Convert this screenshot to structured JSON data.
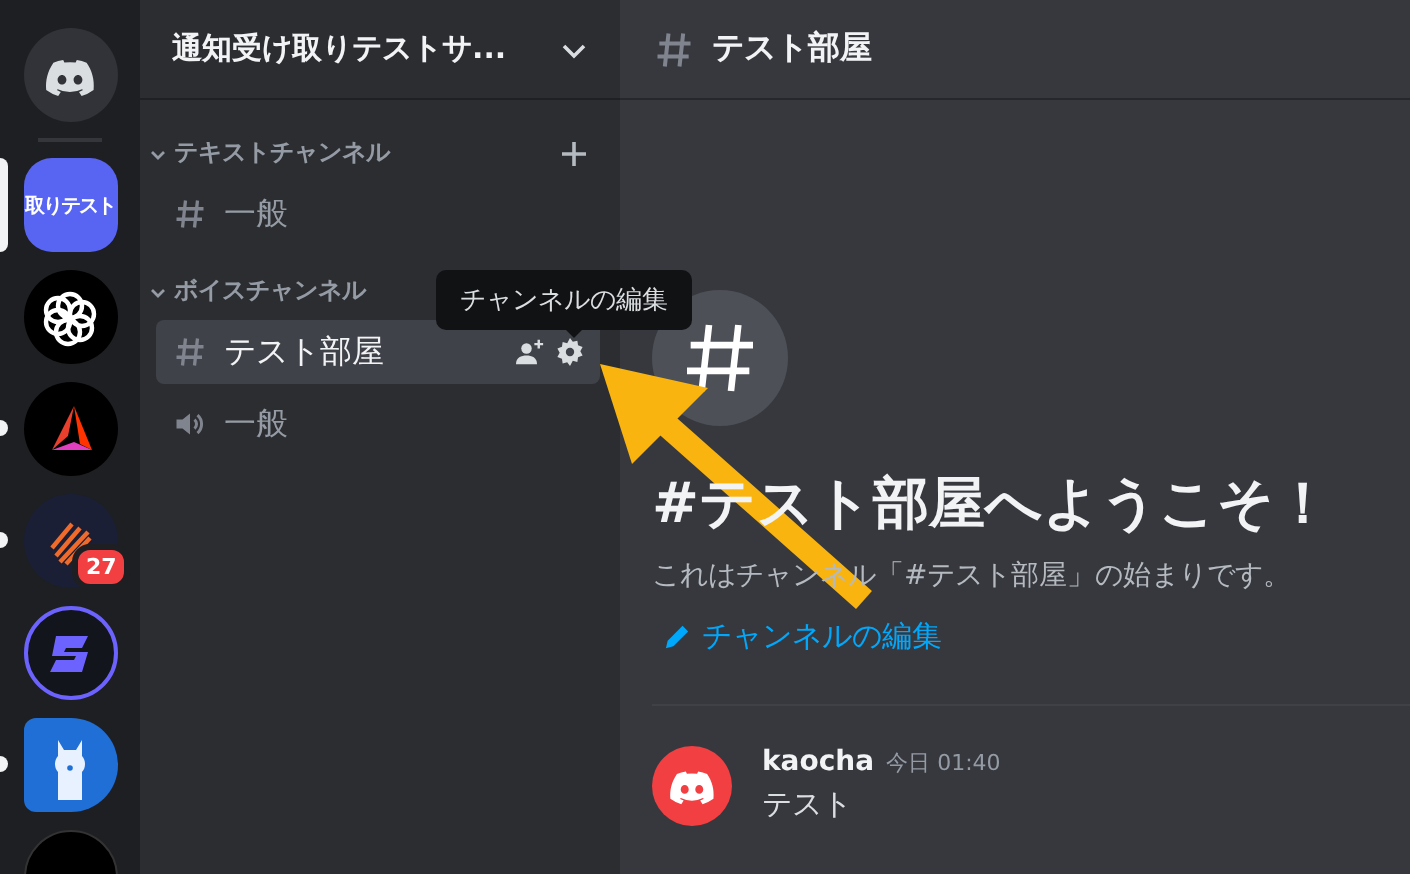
{
  "servers": [
    {
      "kind": "home",
      "selected": false,
      "unread": false
    },
    {
      "kind": "label",
      "label": "取りテスト",
      "selected": true,
      "unread": false
    },
    {
      "kind": "knot",
      "selected": false,
      "unread": false
    },
    {
      "kind": "triangle",
      "selected": false,
      "unread": true
    },
    {
      "kind": "stripes",
      "selected": false,
      "unread": true,
      "badge": "27"
    },
    {
      "kind": "bolt",
      "selected": false,
      "unread": false
    },
    {
      "kind": "llama",
      "selected": false,
      "unread": true
    },
    {
      "kind": "dark",
      "selected": false,
      "unread": false
    }
  ],
  "server_header": {
    "title": "通知受け取りテストサ..."
  },
  "categories": [
    {
      "name": "テキストチャンネル",
      "expanded": true,
      "can_add": true,
      "channels": [
        {
          "kind": "text",
          "name": "一般",
          "selected": false
        }
      ]
    },
    {
      "name": "ボイスチャンネル",
      "expanded": true,
      "can_add": false,
      "channels": [
        {
          "kind": "text",
          "name": "テスト部屋",
          "selected": true
        },
        {
          "kind": "voice",
          "name": "一般",
          "selected": false
        }
      ]
    }
  ],
  "tooltip": {
    "text": "チャンネルの編集"
  },
  "channel_header": {
    "name": "テスト部屋"
  },
  "welcome": {
    "title": "#テスト部屋へようこそ！",
    "subtitle": "これはチャンネル「#テスト部屋」の始まりです。",
    "edit_link": "チャンネルの編集"
  },
  "messages": [
    {
      "author": "kaocha",
      "timestamp": "今日 01:40",
      "content": "テスト"
    }
  ]
}
